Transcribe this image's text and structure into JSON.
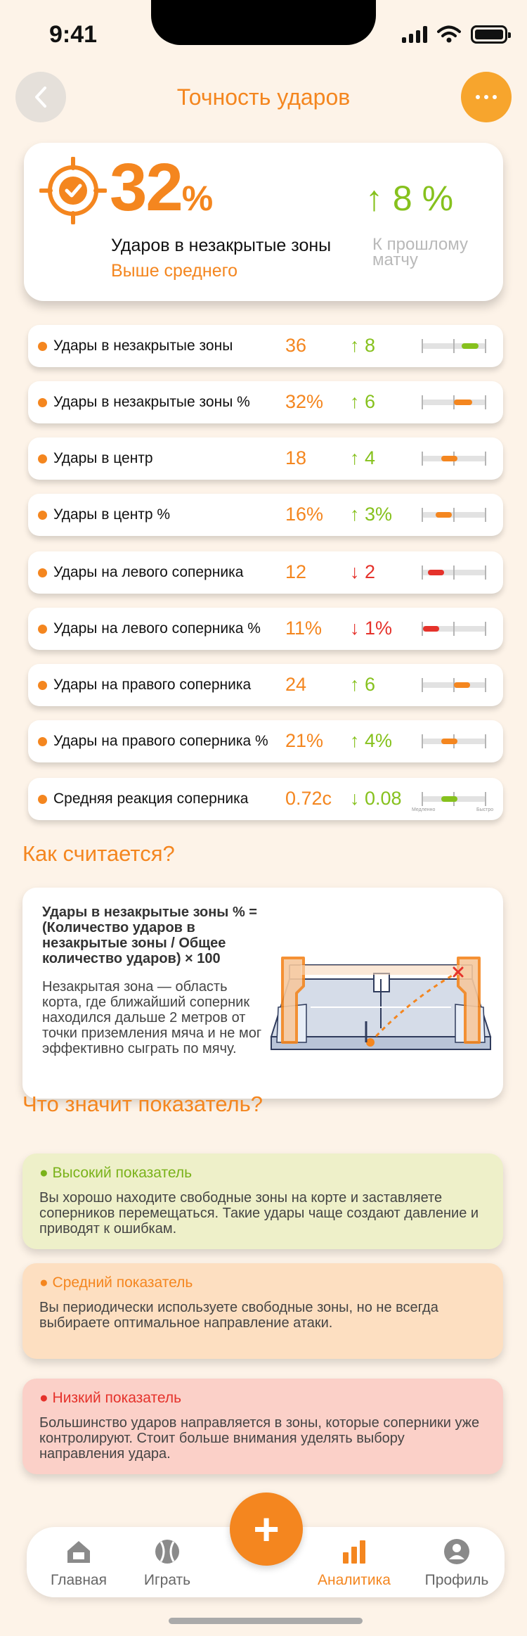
{
  "status_bar": {
    "time": "9:41"
  },
  "header": {
    "title": "Точность ударов"
  },
  "summary": {
    "value": "32",
    "unit": "%",
    "label": "Ударов в незакрытые зоны",
    "sublabel": "Выше среднего",
    "delta": "↑ 8 %",
    "delta_caption": "К прошлому матчу"
  },
  "stats": [
    {
      "label": "Удары в незакрытые зоны",
      "value": "36",
      "delta": "↑ 8",
      "trend": "up",
      "bar": {
        "start": 0.62,
        "end": 0.88,
        "color": "#86c11d"
      }
    },
    {
      "label": "Удары в незакрытые зоны %",
      "value": "32%",
      "delta": "↑ 6",
      "trend": "up",
      "bar": {
        "start": 0.5,
        "end": 0.78,
        "color": "#f4861f"
      }
    },
    {
      "label": "Удары в центр",
      "value": "18",
      "delta": "↑ 4",
      "trend": "up",
      "bar": {
        "start": 0.3,
        "end": 0.55,
        "color": "#f4861f"
      }
    },
    {
      "label": "Удары в центр %",
      "value": "16%",
      "delta": "↑ 3%",
      "trend": "up",
      "bar": {
        "start": 0.22,
        "end": 0.47,
        "color": "#f4861f"
      }
    },
    {
      "label": "Удары на левого соперника",
      "value": "12",
      "delta": "↓ 2",
      "trend": "down",
      "bar": {
        "start": 0.1,
        "end": 0.35,
        "color": "#e5322b"
      }
    },
    {
      "label": "Удары на левого соперника %",
      "value": "11%",
      "delta": "↓ 1%",
      "trend": "down",
      "bar": {
        "start": 0.02,
        "end": 0.27,
        "color": "#e5322b"
      }
    },
    {
      "label": "Удары на правого соперника",
      "value": "24",
      "delta": "↑ 6",
      "trend": "up",
      "bar": {
        "start": 0.5,
        "end": 0.75,
        "color": "#f4861f"
      }
    },
    {
      "label": "Удары на правого соперника %",
      "value": "21%",
      "delta": "↑ 4%",
      "trend": "up",
      "bar": {
        "start": 0.3,
        "end": 0.55,
        "color": "#f4861f"
      }
    },
    {
      "label": "Средняя реакция соперника",
      "value": "0.72с",
      "delta": "↓ 0.08",
      "trend": "up",
      "bar": {
        "start": 0.3,
        "end": 0.55,
        "color": "#86c11d"
      },
      "captions": {
        "left": "Медленно",
        "right": "Быстро"
      }
    }
  ],
  "calc": {
    "title": "Как считается?",
    "formula": "Удары в незакрытые зоны % = (Количество ударов в незакрытые зоны / Общее количество ударов) × 100",
    "description": "Незакрытая зона — область корта, где ближайший соперник находился дальше 2 метров от точки приземления мяча и не мог эффективно сыграть по мячу."
  },
  "meaning": {
    "title": "Что значит показатель?",
    "high": {
      "title": "Высокий показатель",
      "text": "Вы хорошо находите свободные зоны на корте и заставляете соперников перемещаться. Такие удары чаще создают давление и приводят к ошибкам."
    },
    "mid": {
      "title": "Средний показатель",
      "text": "Вы периодически используете свободные зоны, но не всегда выбираете оптимальное направление атаки."
    },
    "low": {
      "title": "Низкий показатель",
      "text": "Большинство ударов направляется в зоны, которые соперники уже контролируют. Стоит больше внимания уделять выбору направления удара."
    }
  },
  "tabs": [
    {
      "label": "Главная",
      "icon": "home-icon"
    },
    {
      "label": "Играть",
      "icon": "ball-icon"
    },
    {
      "label": "Аналитика",
      "icon": "analytics-icon",
      "active": true
    },
    {
      "label": "Профиль",
      "icon": "profile-icon"
    }
  ],
  "fab": {
    "label": "+"
  },
  "colors": {
    "accent": "#f4861f",
    "up": "#86c11d",
    "down": "#e5322b"
  }
}
